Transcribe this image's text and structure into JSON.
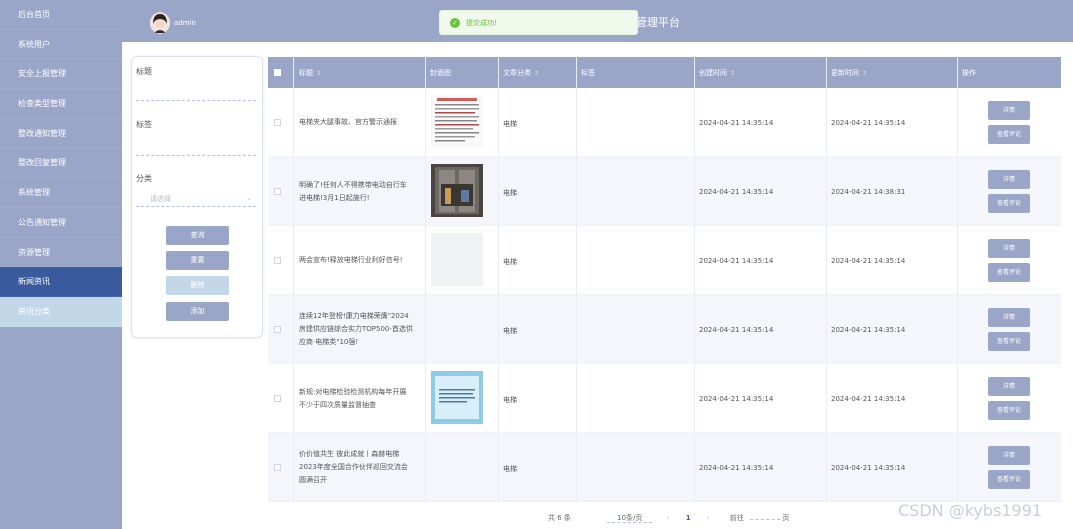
{
  "sidebar": {
    "items": [
      {
        "label": "后台首页"
      },
      {
        "label": "系统用户"
      },
      {
        "label": "安全上报管理"
      },
      {
        "label": "检查类型管理"
      },
      {
        "label": "整改通知管理"
      },
      {
        "label": "整改回复管理"
      },
      {
        "label": "系统管理"
      },
      {
        "label": "公告通知管理"
      },
      {
        "label": "资源管理"
      },
      {
        "label": "新闻资讯"
      },
      {
        "label": "资讯分类"
      }
    ]
  },
  "header": {
    "username": "admin",
    "title": "管理平台"
  },
  "toast": {
    "text": "提交成功!"
  },
  "search": {
    "title_label": "标题",
    "tag_label": "标签",
    "category_label": "分类",
    "category_placeholder": "请选择",
    "query_btn": "查询",
    "reset_btn": "重置",
    "delete_btn": "删除",
    "add_btn": "添加"
  },
  "table": {
    "headers": {
      "title": "标题",
      "cover": "封面图",
      "category": "文章分类",
      "tags": "标签",
      "created": "创建时间",
      "updated": "更新时间",
      "actions": "操作"
    },
    "detail_label": "详情",
    "comment_label": "查看评论",
    "rows": [
      {
        "title": "电梯夹大腿事故、官方警示通报",
        "category": "电梯",
        "created": "2024-04-21 14:35:14",
        "updated": "2024-04-21 14:35:14"
      },
      {
        "title": "明确了!任何人不得携带电动自行车进电梯!3月1日起施行!",
        "category": "电梯",
        "created": "2024-04-21 14:35:14",
        "updated": "2024-04-21 14:38:31"
      },
      {
        "title": "两会宣布!释放电梯行业利好信号!",
        "category": "电梯",
        "created": "2024-04-21 14:35:14",
        "updated": "2024-04-21 14:35:14"
      },
      {
        "title": "连续12年登榜!康力电梯荣膺\"2024房建供应链综合实力TOP500-首选供应商·电梯类\"10强!",
        "category": "电梯",
        "created": "2024-04-21 14:35:14",
        "updated": "2024-04-21 14:35:14"
      },
      {
        "title": "新规:对电梯检验检测机构每年开展不少于四次质量监督抽查",
        "category": "电梯",
        "created": "2024-04-21 14:35:14",
        "updated": "2024-04-21 14:35:14"
      },
      {
        "title": "价价值共生 彼此成就丨森赫电梯2023年度全国合作伙伴巡回交流会圆满召开",
        "category": "电梯",
        "created": "2024-04-21 14:35:14",
        "updated": "2024-04-21 14:35:14"
      }
    ]
  },
  "pager": {
    "total": "共 6 条",
    "size": "10条/页",
    "page": "1",
    "goto": "前往",
    "page_unit": "页"
  },
  "watermark": "CSDN @kybs1991",
  "colors": {
    "sidebar": "#9aa6c8",
    "active": "#3a5a9e",
    "sub": "#c2d8e8",
    "success": "#67c23a"
  }
}
